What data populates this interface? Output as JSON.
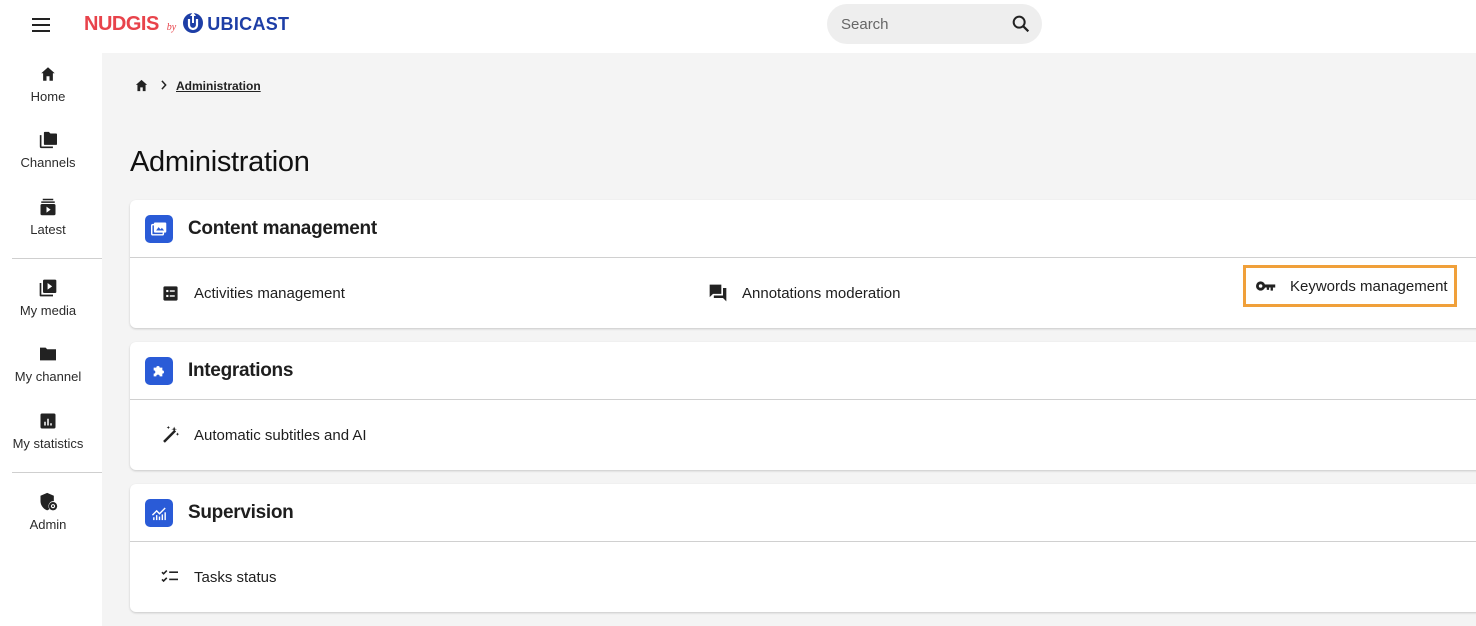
{
  "header": {
    "logo": {
      "brand": "NUDGIS",
      "by": "by",
      "company": "UBICAST"
    },
    "search": {
      "placeholder": "Search"
    }
  },
  "sidebar": {
    "items": [
      {
        "label": "Home",
        "icon": "home-icon"
      },
      {
        "label": "Channels",
        "icon": "channels-icon"
      },
      {
        "label": "Latest",
        "icon": "latest-icon"
      },
      {
        "label": "My media",
        "icon": "my-media-icon"
      },
      {
        "label": "My channel",
        "icon": "folder-icon"
      },
      {
        "label": "My statistics",
        "icon": "statistics-icon"
      },
      {
        "label": "Admin",
        "icon": "admin-shield-icon"
      }
    ]
  },
  "breadcrumb": {
    "current": "Administration"
  },
  "page": {
    "title": "Administration"
  },
  "sections": [
    {
      "title": "Content management",
      "icon": "content-management-icon",
      "items": [
        {
          "label": "Activities management",
          "icon": "list-icon"
        },
        {
          "label": "Annotations moderation",
          "icon": "forum-icon"
        },
        {
          "label": "Keywords management",
          "icon": "key-icon",
          "highlighted": true
        }
      ]
    },
    {
      "title": "Integrations",
      "icon": "puzzle-icon",
      "items": [
        {
          "label": "Automatic subtitles and AI",
          "icon": "magic-wand-icon"
        }
      ]
    },
    {
      "title": "Supervision",
      "icon": "analytics-icon",
      "items": [
        {
          "label": "Tasks status",
          "icon": "checklist-icon"
        }
      ]
    }
  ],
  "colors": {
    "accent": "#2a5bd7",
    "highlight": "#f0a03a",
    "brand_red": "#e8434b",
    "brand_blue": "#1d3ea6"
  }
}
